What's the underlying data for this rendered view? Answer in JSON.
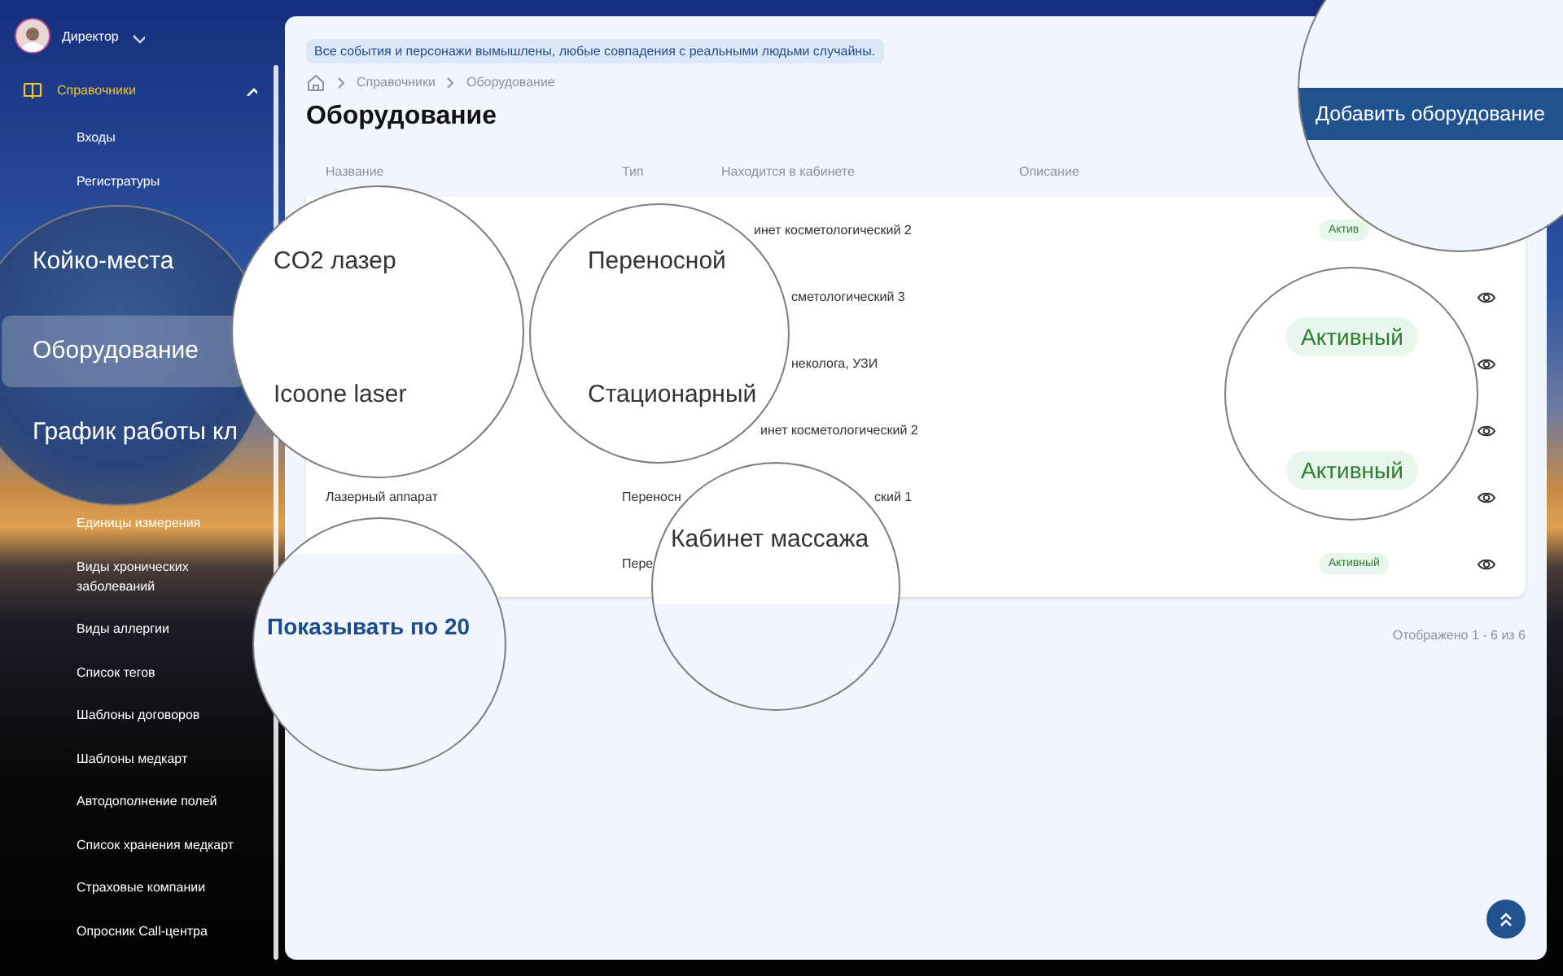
{
  "user": {
    "name": "Директор"
  },
  "sidebar": {
    "section": {
      "label": "Справочники",
      "expanded": true
    },
    "items_before": [
      {
        "label": "Входы"
      },
      {
        "label": "Регистратуры"
      }
    ],
    "items_after": [
      {
        "label": "Единицы измерения"
      },
      {
        "label": "Виды хронических заболеваний"
      },
      {
        "label": "Виды аллергии"
      },
      {
        "label": "Список тегов"
      },
      {
        "label": "Шаблоны договоров"
      },
      {
        "label": "Шаблоны медкарт"
      },
      {
        "label": "Автодополнение полей"
      },
      {
        "label": "Список хранения медкарт"
      },
      {
        "label": "Страховые компании"
      },
      {
        "label": "Опросник Call-центра"
      }
    ]
  },
  "notice": "Все события и персонажи вымышлены, любые совпадения с реальными людьми случайны.",
  "breadcrumb": [
    "Справочники",
    "Оборудование"
  ],
  "title": "Оборудование",
  "table": {
    "columns": [
      "Название",
      "Тип",
      "Находится в кабинете",
      "Описание"
    ],
    "rows": [
      {
        "location": "инет косметологический 2",
        "status": "Актив"
      },
      {
        "location": "сметологический 3",
        "view_button": true
      },
      {
        "location": "неколога, УЗИ",
        "view_button": true
      },
      {
        "location": "инет косметологический 2",
        "view_button": true
      },
      {
        "name": "Лазерный аппарат",
        "type": "Переносн",
        "location": "ский 1",
        "view_button": true
      },
      {
        "type": "Пере",
        "status": "Активный",
        "view_button": true
      }
    ]
  },
  "pagination": {
    "summary": "Отображено 1 - 6 из 6"
  },
  "magnifiers": [
    {
      "kind": "button",
      "items": [
        {
          "text": "Добавить оборудование"
        }
      ]
    },
    {
      "kind": "menu",
      "items": [
        {
          "text": "Койко-места",
          "selected": false
        },
        {
          "text": "Оборудование",
          "selected": true
        },
        {
          "text": "График работы кл",
          "selected": false
        }
      ]
    },
    {
      "kind": "cells",
      "items": [
        {
          "text": "CO2 лазер"
        },
        {
          "text": "Icoone laser"
        }
      ]
    },
    {
      "kind": "cells",
      "items": [
        {
          "text": "Переносной"
        },
        {
          "text": "Стационарный"
        }
      ]
    },
    {
      "kind": "link",
      "items": [
        {
          "text": "Показывать по 20"
        }
      ]
    },
    {
      "kind": "cells",
      "items": [
        {
          "text": "Кабинет массажа"
        }
      ]
    },
    {
      "kind": "badges",
      "items": [
        {
          "text": "Активный"
        },
        {
          "text": "Активный"
        }
      ]
    }
  ]
}
